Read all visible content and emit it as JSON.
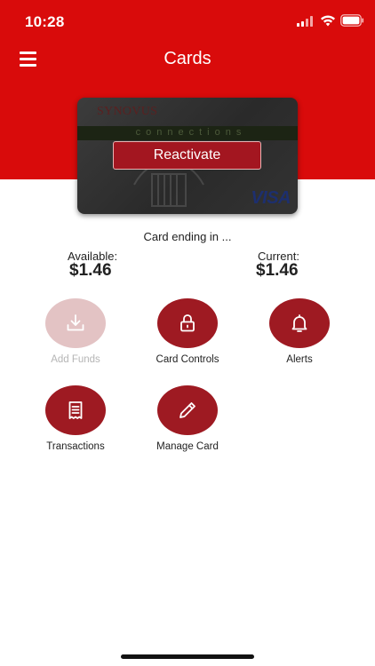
{
  "status_bar": {
    "time": "10:28"
  },
  "header": {
    "title": "Cards"
  },
  "card": {
    "brand": "SYNOVUS",
    "subtitle": "connections",
    "network": "VISA",
    "reactivate_label": "Reactivate",
    "ending_text": "Card ending in ..."
  },
  "balances": {
    "available_label": "Available:",
    "available_value": "$1.46",
    "current_label": "Current:",
    "current_value": "$1.46"
  },
  "actions": [
    {
      "label": "Add Funds",
      "icon": "download-icon",
      "enabled": false
    },
    {
      "label": "Card Controls",
      "icon": "lock-icon",
      "enabled": true
    },
    {
      "label": "Alerts",
      "icon": "bell-icon",
      "enabled": true
    },
    {
      "label": "Transactions",
      "icon": "receipt-icon",
      "enabled": true
    },
    {
      "label": "Manage Card",
      "icon": "pencil-icon",
      "enabled": true
    }
  ],
  "colors": {
    "header_red": "#d90b0b",
    "action_red": "#9e1a22",
    "action_disabled": "#e3c3c4"
  }
}
